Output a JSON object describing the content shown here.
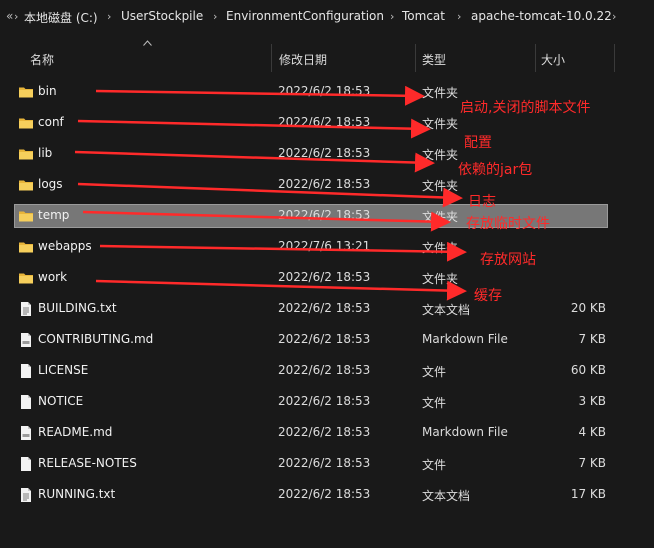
{
  "breadcrumb": {
    "back_glyph": "«",
    "items": [
      "本地磁盘 (C:)",
      "UserStockpile",
      "EnvironmentConfiguration",
      "Tomcat",
      "apache-tomcat-10.0.22"
    ]
  },
  "columns": {
    "name": "名称",
    "date": "修改日期",
    "type": "类型",
    "size": "大小"
  },
  "rows": [
    {
      "name": "bin",
      "date": "2022/6/2 18:53",
      "type": "文件夹",
      "size": "",
      "icon": "folder-icon"
    },
    {
      "name": "conf",
      "date": "2022/6/2 18:53",
      "type": "文件夹",
      "size": "",
      "icon": "folder-icon"
    },
    {
      "name": "lib",
      "date": "2022/6/2 18:53",
      "type": "文件夹",
      "size": "",
      "icon": "folder-icon"
    },
    {
      "name": "logs",
      "date": "2022/6/2 18:53",
      "type": "文件夹",
      "size": "",
      "icon": "folder-icon"
    },
    {
      "name": "temp",
      "date": "2022/6/2 18:53",
      "type": "文件夹",
      "size": "",
      "icon": "folder-icon",
      "selected": true
    },
    {
      "name": "webapps",
      "date": "2022/7/6 13:21",
      "type": "文件夹",
      "size": "",
      "icon": "folder-icon"
    },
    {
      "name": "work",
      "date": "2022/6/2 18:53",
      "type": "文件夹",
      "size": "",
      "icon": "folder-icon"
    },
    {
      "name": "BUILDING.txt",
      "date": "2022/6/2 18:53",
      "type": "文本文档",
      "size": "20 KB",
      "icon": "text-file-icon"
    },
    {
      "name": "CONTRIBUTING.md",
      "date": "2022/6/2 18:53",
      "type": "Markdown File",
      "size": "7 KB",
      "icon": "markdown-file-icon"
    },
    {
      "name": "LICENSE",
      "date": "2022/6/2 18:53",
      "type": "文件",
      "size": "60 KB",
      "icon": "file-icon"
    },
    {
      "name": "NOTICE",
      "date": "2022/6/2 18:53",
      "type": "文件",
      "size": "3 KB",
      "icon": "file-icon"
    },
    {
      "name": "README.md",
      "date": "2022/6/2 18:53",
      "type": "Markdown File",
      "size": "4 KB",
      "icon": "markdown-file-icon"
    },
    {
      "name": "RELEASE-NOTES",
      "date": "2022/6/2 18:53",
      "type": "文件",
      "size": "7 KB",
      "icon": "file-icon"
    },
    {
      "name": "RUNNING.txt",
      "date": "2022/6/2 18:53",
      "type": "文本文档",
      "size": "17 KB",
      "icon": "text-file-icon"
    }
  ],
  "annotations": [
    {
      "for": "bin",
      "text": "启动,关闭的脚本文件"
    },
    {
      "for": "conf",
      "text": "配置"
    },
    {
      "for": "lib",
      "text": "依赖的jar包"
    },
    {
      "for": "logs",
      "text": "日志"
    },
    {
      "for": "temp",
      "text": "存放临时文件"
    },
    {
      "for": "webapps",
      "text": "存放网站"
    },
    {
      "for": "work",
      "text": "缓存"
    }
  ],
  "colors": {
    "background": "#191919",
    "selection": "#777777",
    "folder": "#f0c24b",
    "annotation": "#ff2a2a"
  }
}
